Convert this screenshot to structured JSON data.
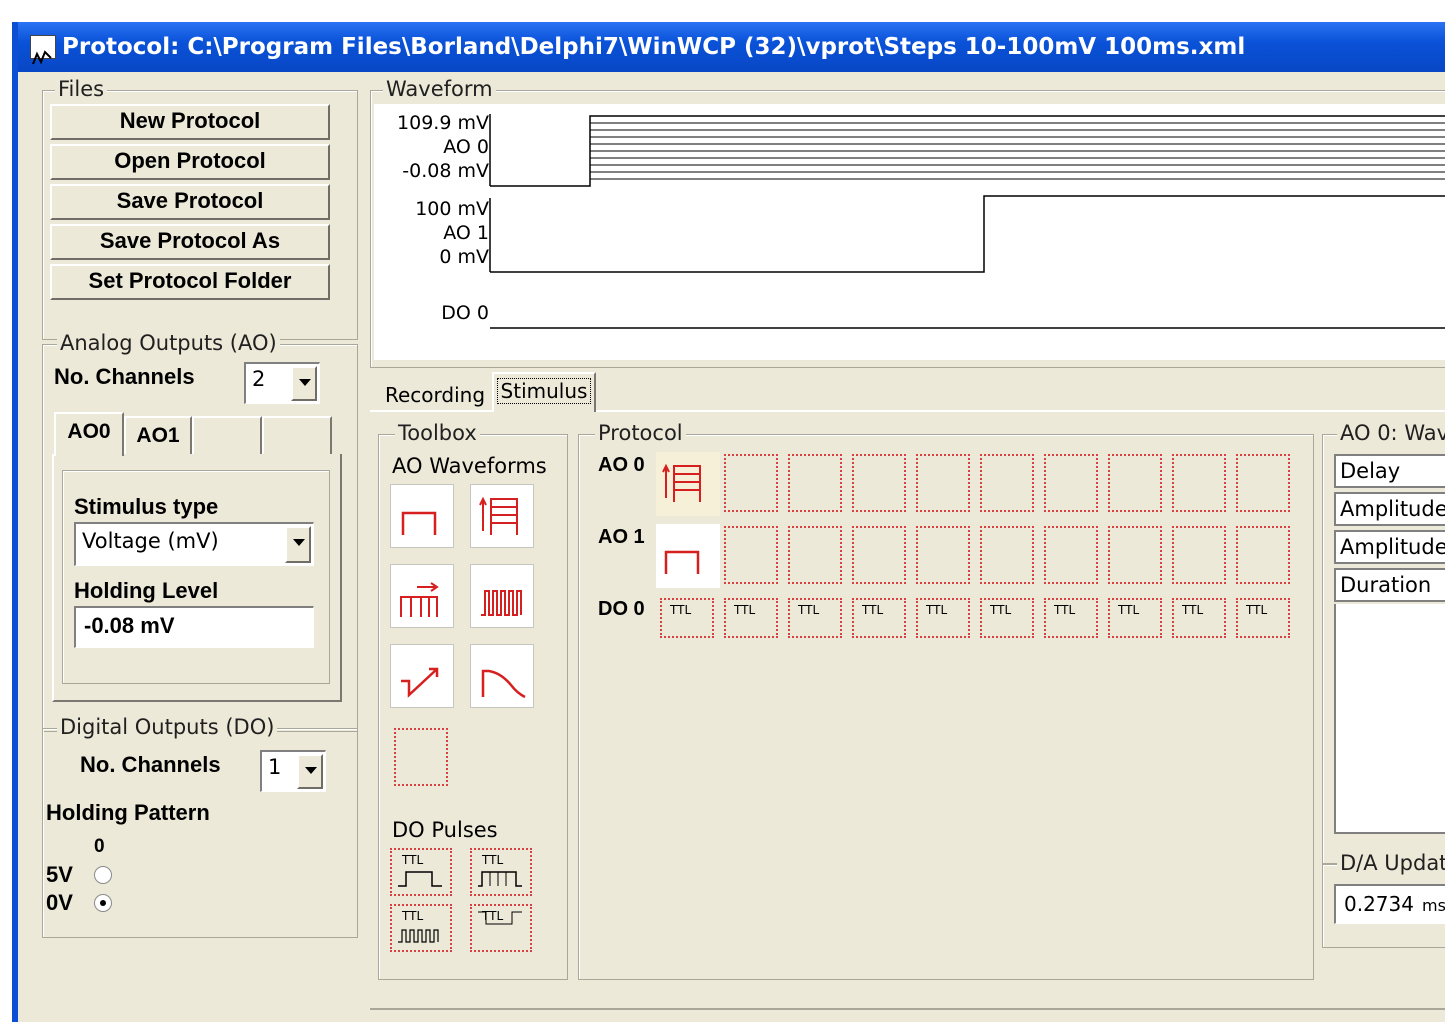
{
  "window": {
    "title": "Protocol: C:\\Program Files\\Borland\\Delphi7\\WinWCP (32)\\vprot\\Steps 10-100mV 100ms.xml"
  },
  "files": {
    "title": "Files",
    "buttons": [
      "New Protocol",
      "Open Protocol",
      "Save Protocol",
      "Save Protocol As",
      "Set Protocol Folder"
    ]
  },
  "analog_outputs": {
    "title": "Analog Outputs (AO)",
    "no_channels_label": "No. Channels",
    "no_channels_value": "2",
    "tabs": [
      "AO0",
      "AO1",
      "",
      ""
    ],
    "stimulus_type_label": "Stimulus type",
    "stimulus_type_value": "Voltage (mV)",
    "holding_level_label": "Holding Level",
    "holding_level_value": "-0.08 mV"
  },
  "digital_outputs": {
    "title": "Digital Outputs (DO)",
    "no_channels_label": "No. Channels",
    "no_channels_value": "1",
    "holding_pattern_label": "Holding Pattern",
    "column_label": "0",
    "row_5v": "5V",
    "row_0v": "0V",
    "selected": "0V"
  },
  "waveform": {
    "title": "Waveform",
    "ao0": {
      "max": "109.9 mV",
      "name": "AO 0",
      "min": "-0.08 mV"
    },
    "ao1": {
      "max": "100 mV",
      "name": "AO 1",
      "min": "0 mV"
    },
    "do0": {
      "name": "DO 0"
    }
  },
  "tabs": {
    "recording": "Recording",
    "stimulus": "Stimulus",
    "active": "Stimulus"
  },
  "toolbox": {
    "title": "Toolbox",
    "ao_waveforms_label": "AO Waveforms",
    "ao_tools": [
      "pulse-icon",
      "step-series-icon",
      "pulse-train-icon",
      "pulse-series-icon",
      "ramp-icon",
      "epsc-icon",
      "empty-icon"
    ],
    "do_pulses_label": "DO Pulses",
    "do_tools": [
      "ttl-pulse-icon",
      "ttl-pulse-train-icon",
      "ttl-series-icon",
      "ttl-empty-icon"
    ]
  },
  "protocol": {
    "title": "Protocol",
    "rows": [
      "AO 0",
      "AO 1",
      "DO 0"
    ],
    "ttl_text": "TTL",
    "cells_per_row": 10
  },
  "properties": {
    "title": "AO 0: Wav",
    "items": [
      "Delay",
      "Amplitude",
      "Amplitude",
      "Duration"
    ]
  },
  "da_update": {
    "title": "D/A Updat",
    "value": "0.2734",
    "unit": "ms"
  },
  "colors": {
    "title_bar": "#0a52d8",
    "window_bg": "#ece9d8",
    "icon_red": "#d62020"
  }
}
